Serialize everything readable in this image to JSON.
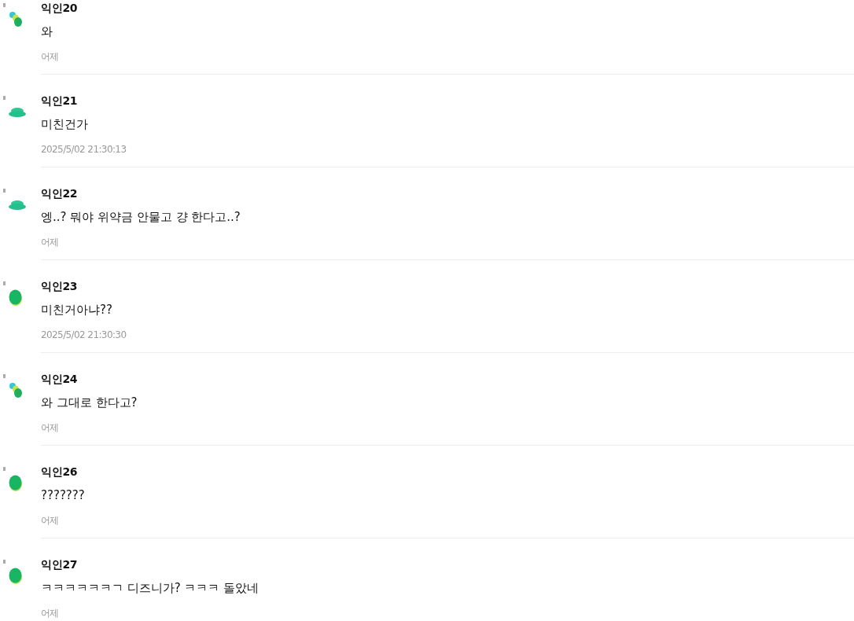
{
  "comments": [
    {
      "author": "익인20",
      "text": "와",
      "time": "어제",
      "kind": "dots"
    },
    {
      "author": "익인21",
      "text": "미친건가",
      "time": "2025/5/02 21:30:13",
      "kind": "cap"
    },
    {
      "author": "익인22",
      "text": "엥..? 뭐야 위약금 안물고 걍 한다고..?",
      "time": "어제",
      "kind": "cap"
    },
    {
      "author": "익인23",
      "text": "미친거아냐??",
      "time": "2025/5/02 21:30:30",
      "kind": "blob"
    },
    {
      "author": "익인24",
      "text": "와 그대로 한다고?",
      "time": "어제",
      "kind": "dots"
    },
    {
      "author": "익인26",
      "text": "???????",
      "time": "어제",
      "kind": "blob"
    },
    {
      "author": "익인27",
      "text": "ㅋㅋㅋㅋㅋㅋㄱ 디즈니가? ㅋㅋㅋ 돌았네",
      "time": "어제",
      "kind": "blob"
    }
  ]
}
